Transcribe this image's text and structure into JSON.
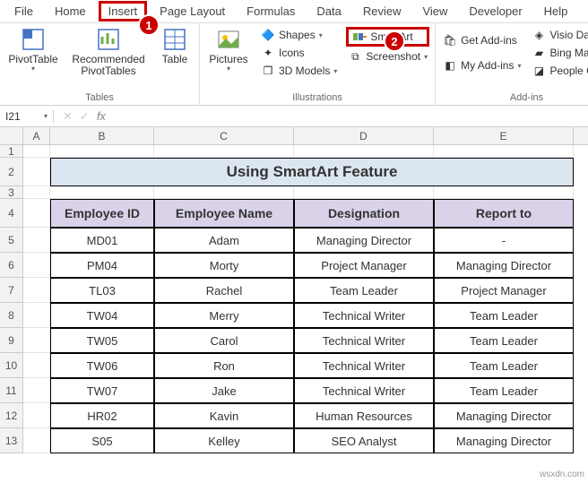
{
  "menu": {
    "file": "File",
    "home": "Home",
    "insert": "Insert",
    "pagelayout": "Page Layout",
    "formulas": "Formulas",
    "data": "Data",
    "review": "Review",
    "view": "View",
    "developer": "Developer",
    "help": "Help"
  },
  "ribbon": {
    "tables": {
      "pivot": "PivotTable",
      "recpivot": "Recommended\nPivotTables",
      "table": "Table",
      "label": "Tables"
    },
    "illus": {
      "pictures": "Pictures",
      "shapes": "Shapes",
      "icons": "Icons",
      "models": "3D Models",
      "smartart": "SmartArt",
      "screenshot": "Screenshot",
      "label": "Illustrations"
    },
    "addins": {
      "get": "Get Add-ins",
      "my": "My Add-ins",
      "visio": "Visio Data V",
      "bing": "Bing Maps",
      "people": "People Grap",
      "label": "Add-ins"
    }
  },
  "callouts": {
    "one": "1",
    "two": "2"
  },
  "namebox": "I21",
  "fx": "fx",
  "cols": {
    "A": "A",
    "B": "B",
    "C": "C",
    "D": "D",
    "E": "E"
  },
  "rows": {
    "r1": "1",
    "r2": "2",
    "r3": "3",
    "r4": "4",
    "r5": "5",
    "r6": "6",
    "r7": "7",
    "r8": "8",
    "r9": "9",
    "r10": "10",
    "r11": "11",
    "r12": "12",
    "r13": "13"
  },
  "title": "Using SmartArt Feature",
  "headers": {
    "id": "Employee ID",
    "name": "Employee Name",
    "desig": "Designation",
    "report": "Report to"
  },
  "data": [
    {
      "id": "MD01",
      "name": "Adam",
      "desig": "Managing Director",
      "report": "-"
    },
    {
      "id": "PM04",
      "name": "Morty",
      "desig": "Project Manager",
      "report": "Managing Director"
    },
    {
      "id": "TL03",
      "name": "Rachel",
      "desig": "Team Leader",
      "report": "Project Manager"
    },
    {
      "id": "TW04",
      "name": "Merry",
      "desig": "Technical Writer",
      "report": "Team Leader"
    },
    {
      "id": "TW05",
      "name": "Carol",
      "desig": "Technical Writer",
      "report": "Team Leader"
    },
    {
      "id": "TW06",
      "name": "Ron",
      "desig": "Technical Writer",
      "report": "Team Leader"
    },
    {
      "id": "TW07",
      "name": "Jake",
      "desig": "Technical Writer",
      "report": "Team Leader"
    },
    {
      "id": "HR02",
      "name": "Kavin",
      "desig": "Human Resources",
      "report": "Managing Director"
    },
    {
      "id": "S05",
      "name": "Kelley",
      "desig": "SEO Analyst",
      "report": "Managing Director"
    }
  ],
  "watermark": "wsxdn.com"
}
